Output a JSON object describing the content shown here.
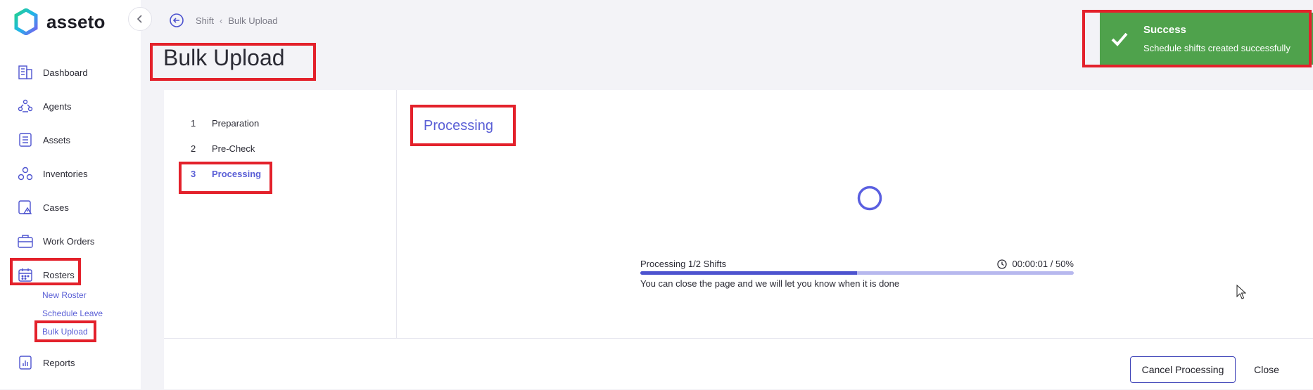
{
  "app": {
    "name": "asseto"
  },
  "sidebar": {
    "items": [
      {
        "label": "Dashboard",
        "icon": "building-icon"
      },
      {
        "label": "Agents",
        "icon": "agents-icon"
      },
      {
        "label": "Assets",
        "icon": "assets-icon"
      },
      {
        "label": "Inventories",
        "icon": "inventories-icon"
      },
      {
        "label": "Cases",
        "icon": "cases-icon"
      },
      {
        "label": "Work Orders",
        "icon": "briefcase-icon"
      },
      {
        "label": "Rosters",
        "icon": "calendar-icon"
      },
      {
        "label": "Reports",
        "icon": "reports-icon"
      }
    ],
    "rosters_sub": [
      "New Roster",
      "Schedule Leave",
      "Bulk Upload"
    ]
  },
  "breadcrumb": {
    "parent": "Shift",
    "current": "Bulk Upload"
  },
  "page": {
    "title": "Bulk Upload"
  },
  "steps": [
    {
      "num": "1",
      "label": "Preparation"
    },
    {
      "num": "2",
      "label": "Pre-Check"
    },
    {
      "num": "3",
      "label": "Processing"
    }
  ],
  "processing": {
    "title": "Processing",
    "status": "Processing 1/2 Shifts",
    "time": "00:00:01 / 50%",
    "progress_percent": 50,
    "note": "You can close the page and we will let you know when it is done"
  },
  "footer": {
    "cancel_label": "Cancel Processing",
    "close_label": "Close"
  },
  "toast": {
    "title": "Success",
    "message": "Schedule shifts created successfully"
  },
  "colors": {
    "accent": "#5a5fd6",
    "success": "#4fa24c",
    "highlight": "#e3212b"
  }
}
